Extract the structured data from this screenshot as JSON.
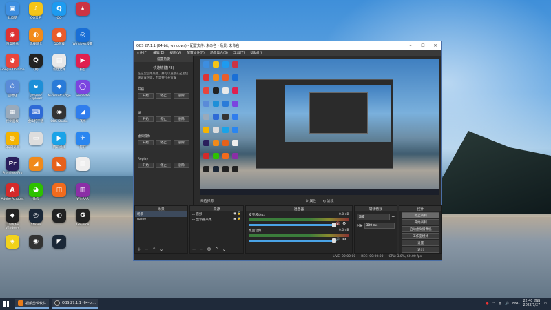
{
  "desktop": {
    "icons": [
      {
        "label": "此电脑",
        "color": "#3d8ee0",
        "glyph": "▣"
      },
      {
        "label": "QQ音乐",
        "color": "#f5c518",
        "glyph": "♪"
      },
      {
        "label": "QQ",
        "color": "#1d9bf0",
        "glyph": "Q"
      },
      {
        "label": "",
        "color": "#cc3344",
        "glyph": "★"
      },
      {
        "label": "百度网盘",
        "color": "#d33",
        "glyph": "◉"
      },
      {
        "label": "无线网卡",
        "color": "#f28b1b",
        "glyph": "◐"
      },
      {
        "label": "QQ游戏",
        "color": "#e85c2c",
        "glyph": "●"
      },
      {
        "label": "Windows设置",
        "color": "#1a6fd6",
        "glyph": "◎"
      },
      {
        "label": "Google Chrome",
        "color": "#e8453c",
        "glyph": "◕"
      },
      {
        "label": "QQ",
        "color": "#222",
        "glyph": "Q"
      },
      {
        "label": "新建文件",
        "color": "#e9e9e9",
        "glyph": "▤"
      },
      {
        "label": "抖音",
        "color": "#e02050",
        "glyph": "▶"
      },
      {
        "label": "回收站",
        "color": "#5a8bd8",
        "glyph": "♺"
      },
      {
        "label": "Internet Explorer",
        "color": "#1d8fd8",
        "glyph": "e"
      },
      {
        "label": "Microsoft Edge",
        "color": "#2a7bd8",
        "glyph": "◆"
      },
      {
        "label": "Snipaste",
        "color": "#7b45e0",
        "glyph": "◯"
      },
      {
        "label": "控制面板",
        "color": "#9ab",
        "glyph": "▦"
      },
      {
        "label": "金山打字通",
        "color": "#2e6ad6",
        "glyph": "⌨"
      },
      {
        "label": "OBS Studio",
        "color": "#333",
        "glyph": "◉"
      },
      {
        "label": "飞书",
        "color": "#2f7ded",
        "glyph": "◢"
      },
      {
        "label": "QQ浏览器",
        "color": "#f5b400",
        "glyph": "◍"
      },
      {
        "label": "",
        "color": "#ddd",
        "glyph": "▭"
      },
      {
        "label": "腾讯视频",
        "color": "#1aa3e8",
        "glyph": "▶"
      },
      {
        "label": "钉钉",
        "color": "#2a86f0",
        "glyph": "✈"
      },
      {
        "label": "Premiere Pro",
        "color": "#2a1f5c",
        "glyph": "Pr"
      },
      {
        "label": "",
        "color": "#f08a1b",
        "glyph": "◢"
      },
      {
        "label": "",
        "color": "#e6611b",
        "glyph": "◣"
      },
      {
        "label": "",
        "color": "#eee",
        "glyph": "▤"
      },
      {
        "label": "Adobe Acrobat",
        "color": "#d42a2a",
        "glyph": "A"
      },
      {
        "label": "微信",
        "color": "#2dc100",
        "glyph": "◕"
      },
      {
        "label": "",
        "color": "#f26b1d",
        "glyph": "◫"
      },
      {
        "label": "WinRAR",
        "color": "#8b2fa6",
        "glyph": "▥"
      },
      {
        "label": "Clash for Windows",
        "color": "#222",
        "glyph": "◆"
      },
      {
        "label": "Steam",
        "color": "#1b2838",
        "glyph": "◎"
      },
      {
        "label": "",
        "color": "#222",
        "glyph": "◐"
      },
      {
        "label": "GeForce",
        "color": "#222",
        "glyph": "G"
      },
      {
        "label": "",
        "color": "#f2d21b",
        "glyph": "◈"
      },
      {
        "label": "",
        "color": "#333",
        "glyph": "◉"
      },
      {
        "label": "",
        "color": "#1b2838",
        "glyph": "◤"
      }
    ]
  },
  "obs": {
    "title": "OBS 27.1.1 (64-bit, windows) - 配置文件: 未命名 - 场景: 未命名",
    "menu": [
      "文件(F)",
      "编辑(E)",
      "视图(V)",
      "配置文件(P)",
      "场景集合(S)",
      "工具(T)",
      "帮助(H)"
    ],
    "side": {
      "header": "设置热键",
      "title": "快速热键(F8)",
      "desc": "在这里启用热键，并可以直接从这里快速设置热键，不需要打开设置",
      "groups": [
        {
          "name": "开播",
          "buttons": [
            "开始",
            "停止",
            "删除"
          ]
        },
        {
          "name": "录",
          "buttons": [
            "开始",
            "停止",
            "删除"
          ]
        },
        {
          "name": "虚拟摄像",
          "buttons": [
            "开始",
            "停止",
            "删除"
          ]
        },
        {
          "name": "Replay",
          "buttons": [
            "开始",
            "停止",
            "删除"
          ]
        }
      ]
    },
    "preview_status": {
      "scene_label": "未选择源",
      "props": "属性",
      "filters": "滤镜"
    },
    "docks": {
      "scenes": {
        "title": "场景",
        "items": [
          "场景",
          "game"
        ]
      },
      "sources": {
        "title": "来源",
        "items": [
          "音频",
          "显示器采集"
        ]
      },
      "mixer": {
        "title": "混音器",
        "rows": [
          {
            "name": "麦克风/Aux",
            "db": "0.0 dB"
          },
          {
            "name": "桌面音频",
            "db": "0.0 dB"
          }
        ]
      },
      "transitions": {
        "title": "转场特效",
        "type": "渐变",
        "duration_label": "时长",
        "duration": "300 ms"
      },
      "controls": {
        "title": "控件",
        "buttons": [
          "停止录制",
          "开始录制",
          "启动虚拟摄像机",
          "工作室模式",
          "设置",
          "退出"
        ]
      }
    },
    "statusbar": {
      "live": "LIVE: 00:00:00",
      "rec": "REC: 00:00:00",
      "cpu": "CPU: 3.0%, 60.00 fps"
    }
  },
  "taskbar": {
    "apps": [
      {
        "label": "视频剪辑软件",
        "color": "#e87c1b"
      },
      {
        "label": "OBS 27.1.1 (64-bi...",
        "color": "#333"
      }
    ],
    "lang": "ENG",
    "time": "22:40 周四",
    "date": "2022/1/27"
  }
}
